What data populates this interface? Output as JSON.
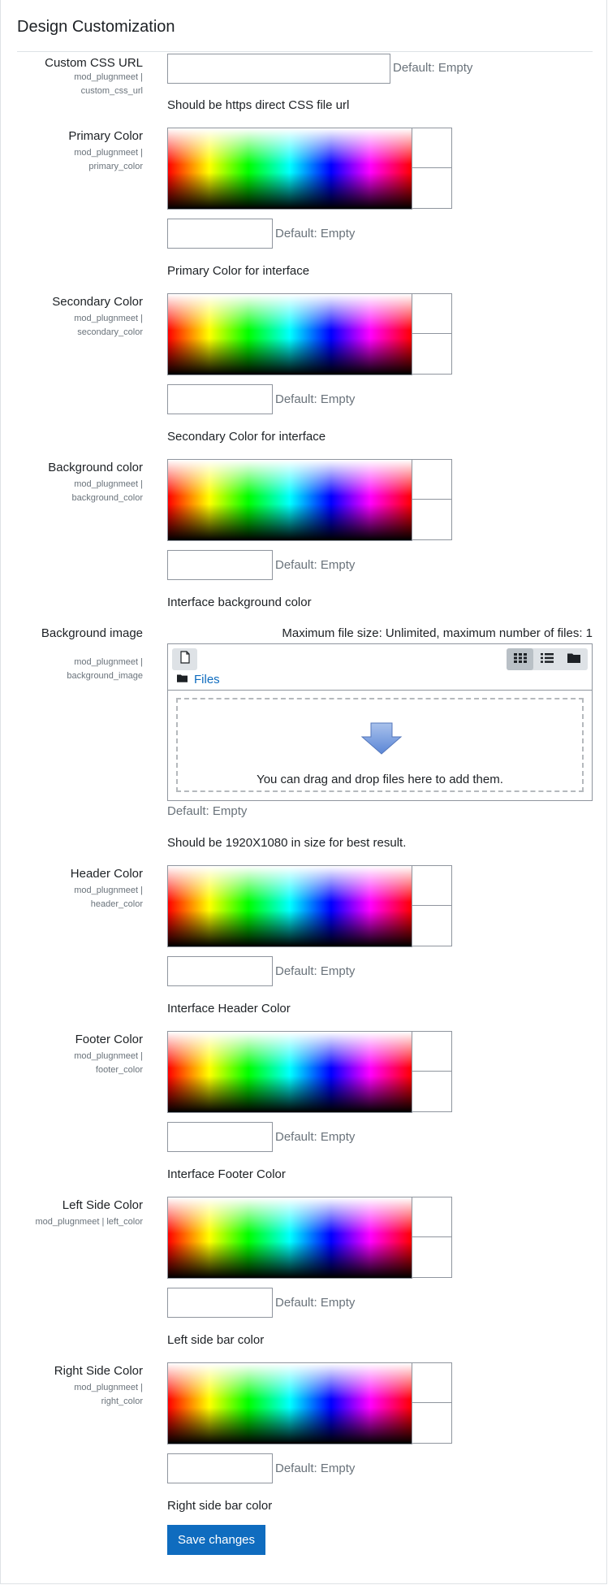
{
  "section": {
    "title": "Design Customization"
  },
  "custom_css": {
    "label": "Custom CSS URL",
    "sub1": "mod_plugnmeet |",
    "sub2": "custom_css_url",
    "value": "",
    "default": "Default: Empty",
    "description": "Should be https direct CSS file url"
  },
  "colors": {
    "primary": {
      "label": "Primary Color",
      "sub1": "mod_plugnmeet |",
      "sub2": "primary_color",
      "value": "",
      "default": "Default: Empty",
      "description": "Primary Color for interface"
    },
    "secondary": {
      "label": "Secondary Color",
      "sub1": "mod_plugnmeet |",
      "sub2": "secondary_color",
      "value": "",
      "default": "Default: Empty",
      "description": "Secondary Color for interface"
    },
    "background": {
      "label": "Background color",
      "sub1": "mod_plugnmeet |",
      "sub2": "background_color",
      "value": "",
      "default": "Default: Empty",
      "description": "Interface background color"
    },
    "header": {
      "label": "Header Color",
      "sub1": "mod_plugnmeet |",
      "sub2": "header_color",
      "value": "",
      "default": "Default: Empty",
      "description": "Interface Header Color"
    },
    "footer": {
      "label": "Footer Color",
      "sub1": "mod_plugnmeet |",
      "sub2": "footer_color",
      "value": "",
      "default": "Default: Empty",
      "description": "Interface Footer Color"
    },
    "left": {
      "label": "Left Side Color",
      "sub1": "mod_plugnmeet | left_color",
      "value": "",
      "default": "Default: Empty",
      "description": "Left side bar color"
    },
    "right": {
      "label": "Right Side Color",
      "sub1": "mod_plugnmeet |",
      "sub2": "right_color",
      "value": "",
      "default": "Default: Empty",
      "description": "Right side bar color"
    }
  },
  "background_image": {
    "label": "Background image",
    "sub1": "mod_plugnmeet |",
    "sub2": "background_image",
    "limits": "Maximum file size: Unlimited, maximum number of files: 1",
    "folder_link": "Files",
    "drop_text": "You can drag and drop files here to add them.",
    "default": "Default: Empty",
    "description": "Should be 1920X1080 in size for best result."
  },
  "actions": {
    "save_label": "Save changes"
  },
  "theme": {
    "accent": "#0f6cbf",
    "text": "#1d2125",
    "muted": "#6a737b",
    "border": "#8f959e"
  }
}
